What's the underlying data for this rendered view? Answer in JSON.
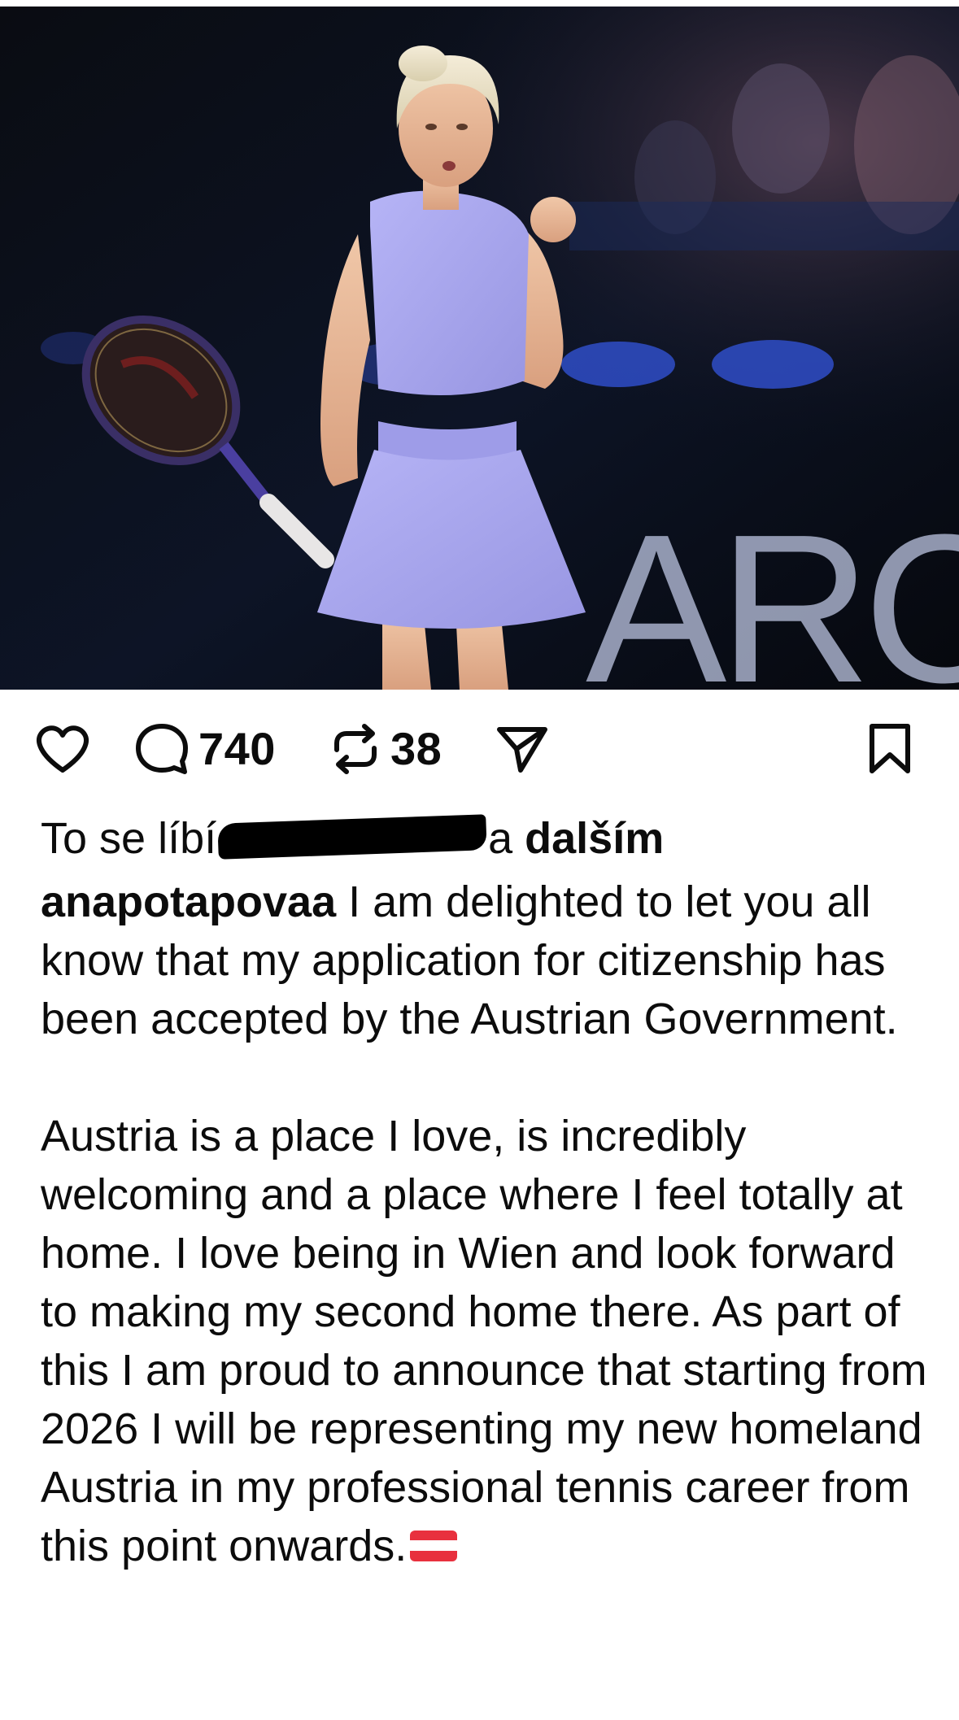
{
  "post": {
    "image_description_icon": "photo",
    "image_text": "ARCO"
  },
  "actions": {
    "like_icon": "heart-icon",
    "comment_icon": "comment-bubble-icon",
    "comments_count": "740",
    "repost_icon": "repost-icon",
    "reposts_count": "38",
    "share_icon": "send-icon",
    "save_icon": "bookmark-icon"
  },
  "likes": {
    "prefix": "To se líbí",
    "suffix_plain": "a ",
    "suffix_bold": "dalším"
  },
  "caption": {
    "username": "anapotapovaa",
    "paragraph1": " I am delighted to let you all know that my application for citizenship has been accepted by the Austrian Government.",
    "paragraph2": "Austria is a place I love, is incredibly welcoming and a place where I feel totally at home. I love being in Wien and look forward to making my second home there. As part of this I am proud to announce that starting from 2026 I will be representing my new homeland Austria in my professional tennis career from this point onwards.",
    "flag_icon": "austria-flag-icon"
  },
  "colors": {
    "text": "#0c0c0c",
    "background": "#ffffff",
    "outfit": "#a8a6ee",
    "flag_red": "#e8303e"
  }
}
